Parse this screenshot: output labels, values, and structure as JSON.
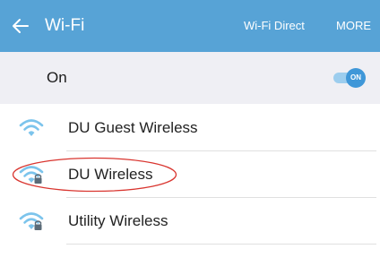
{
  "header": {
    "title": "Wi-Fi",
    "wifi_direct_label": "Wi-Fi Direct",
    "more_label": "MORE",
    "bar_color": "#57a3d6",
    "back_icon": "arrow-left-icon"
  },
  "master_switch": {
    "label": "On",
    "toggle_text": "ON",
    "enabled": true,
    "accent_color": "#3f97d8"
  },
  "networks": [
    {
      "name": "DU Guest Wireless",
      "secured": false,
      "icon": "wifi-signal-icon"
    },
    {
      "name": "DU Wireless",
      "secured": true,
      "icon": "wifi-signal-locked-icon",
      "annotated": true
    },
    {
      "name": "Utility Wireless",
      "secured": true,
      "icon": "wifi-signal-locked-icon"
    }
  ],
  "annotation": {
    "color": "#d9352f",
    "target": "DU Wireless"
  }
}
